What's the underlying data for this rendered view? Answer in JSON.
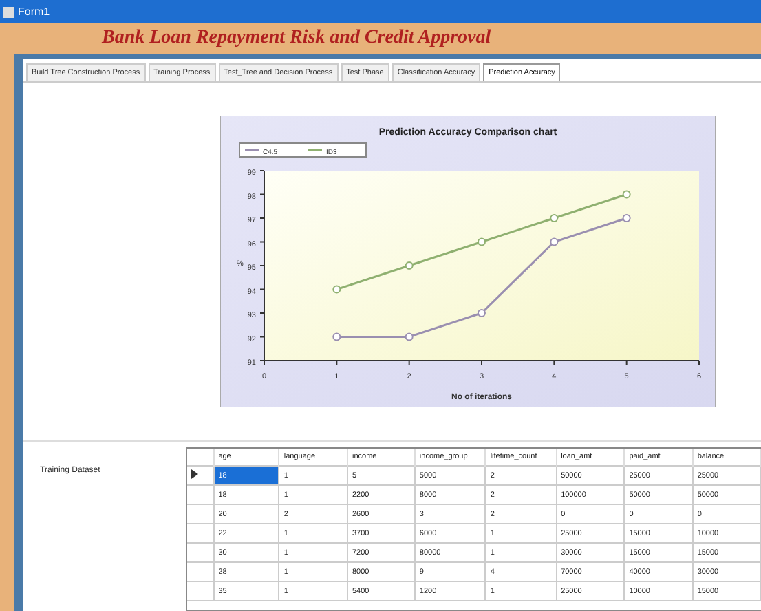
{
  "window": {
    "title": "Form1"
  },
  "header": {
    "title": "Bank Loan Repayment Risk and Credit Approval"
  },
  "tabs": [
    {
      "label": "Build Tree Construction Process",
      "selected": false
    },
    {
      "label": "Training Process",
      "selected": false
    },
    {
      "label": "Test_Tree and Decision Process",
      "selected": false
    },
    {
      "label": "Test Phase",
      "selected": false
    },
    {
      "label": "Classification Accuracy",
      "selected": false
    },
    {
      "label": "Prediction Accuracy",
      "selected": true
    }
  ],
  "chart": {
    "chart_data": {
      "type": "line",
      "title": "Prediction Accuracy Comparison chart",
      "xlabel": "No of iterations",
      "ylabel": "%",
      "x": [
        1,
        2,
        3,
        4,
        5
      ],
      "series": [
        {
          "name": "C4.5",
          "color": "#9a8fb0",
          "marker": "circle",
          "values": [
            92,
            92,
            93,
            96,
            97
          ]
        },
        {
          "name": "ID3",
          "color": "#8fb070",
          "marker": "circle",
          "values": [
            94,
            95,
            96,
            97,
            98
          ]
        }
      ],
      "legend": "top-left",
      "xlim": [
        0,
        6
      ],
      "ylim": [
        91,
        99
      ],
      "xticks": [
        0,
        1,
        2,
        3,
        4,
        5,
        6
      ],
      "yticks": [
        91,
        92,
        93,
        94,
        95,
        96,
        97,
        98,
        99
      ]
    }
  },
  "dataset": {
    "label": "Training Dataset",
    "columns": [
      "age",
      "language",
      "income",
      "income_group",
      "lifetime_count",
      "loan_amt",
      "paid_amt",
      "balance"
    ],
    "rows": [
      {
        "selected": true,
        "cells": [
          "18",
          "1",
          "5",
          "5000",
          "2",
          "50000",
          "25000",
          "25000"
        ]
      },
      {
        "selected": false,
        "cells": [
          "18",
          "1",
          "2200",
          "8000",
          "2",
          "100000",
          "50000",
          "50000"
        ]
      },
      {
        "selected": false,
        "cells": [
          "20",
          "2",
          "2600",
          "3",
          "2",
          "0",
          "0",
          "0"
        ]
      },
      {
        "selected": false,
        "cells": [
          "22",
          "1",
          "3700",
          "6000",
          "1",
          "25000",
          "15000",
          "10000"
        ]
      },
      {
        "selected": false,
        "cells": [
          "30",
          "1",
          "7200",
          "80000",
          "1",
          "30000",
          "15000",
          "15000"
        ]
      },
      {
        "selected": false,
        "cells": [
          "28",
          "1",
          "8000",
          "9",
          "4",
          "70000",
          "40000",
          "30000"
        ]
      },
      {
        "selected": false,
        "cells": [
          "35",
          "1",
          "5400",
          "1200",
          "1",
          "25000",
          "10000",
          "15000"
        ]
      }
    ]
  }
}
